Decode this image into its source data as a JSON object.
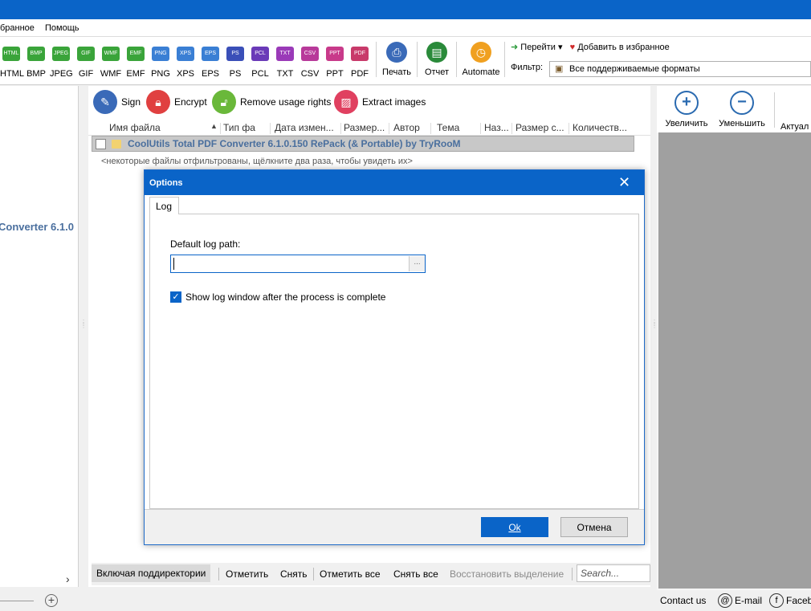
{
  "menu": {
    "items": [
      "бранное",
      "Помощь"
    ]
  },
  "toolbar": {
    "formats": [
      {
        "label": "HTML",
        "color": "#3aa43a"
      },
      {
        "label": "BMP",
        "color": "#3aa43a"
      },
      {
        "label": "JPEG",
        "color": "#3aa43a"
      },
      {
        "label": "GIF",
        "color": "#3aa43a"
      },
      {
        "label": "WMF",
        "color": "#3aa43a"
      },
      {
        "label": "EMF",
        "color": "#3aa43a"
      },
      {
        "label": "PNG",
        "color": "#3a7fd4"
      },
      {
        "label": "XPS",
        "color": "#3a7fd4"
      },
      {
        "label": "EPS",
        "color": "#3a7fd4"
      },
      {
        "label": "PS",
        "color": "#3a4fb8"
      },
      {
        "label": "PCL",
        "color": "#6a3ab8"
      },
      {
        "label": "TXT",
        "color": "#9a3ab8"
      },
      {
        "label": "CSV",
        "color": "#b83a9a"
      },
      {
        "label": "PPT",
        "color": "#c83a8a"
      },
      {
        "label": "PDF",
        "color": "#c83a6a"
      }
    ],
    "print_label": "Печать",
    "report_label": "Отчет",
    "automate_label": "Automate",
    "goto_label": "Перейти",
    "favorites_label": "Добавить в избранное",
    "filter_label": "Фильтр:",
    "filter_value": "Все поддерживаемые форматы"
  },
  "left_panel": {
    "title": "Converter 6.1.0"
  },
  "actions": {
    "sign": "Sign",
    "encrypt": "Encrypt",
    "remove_rights": "Remove usage rights",
    "extract_images": "Extract images"
  },
  "columns": [
    "Имя файла",
    "Тип фа",
    "Дата измен...",
    "Размер...",
    "Автор",
    "Тема",
    "Наз...",
    "Размер с...",
    "Количеств..."
  ],
  "file_row": {
    "name": "CoolUtils Total PDF Converter 6.1.0.150 RePack (& Portable) by TryRooM"
  },
  "filter_note": "<некоторые файлы отфильтрованы, щёлкните два раза, чтобы увидеть их>",
  "bottom_bar": {
    "include_subdirs": "Включая поддиректории",
    "mark": "Отметить",
    "unmark": "Снять",
    "mark_all": "Отметить все",
    "unmark_all": "Снять все",
    "restore_selection": "Восстановить выделение",
    "search_placeholder": "Search..."
  },
  "right_panel": {
    "zoom_in": "Увеличить",
    "zoom_out": "Уменьшить",
    "actual": "Актуал"
  },
  "status": {
    "contact": "Contact us",
    "email": "E-mail",
    "facebook": "Faceb"
  },
  "dialog": {
    "title": "Options",
    "tab": "Log",
    "path_label": "Default log path:",
    "path_value": "",
    "browse": "...",
    "show_log_label": "Show log window after the process is complete",
    "show_log_checked": true,
    "ok": "Ok",
    "cancel": "Отмена"
  }
}
